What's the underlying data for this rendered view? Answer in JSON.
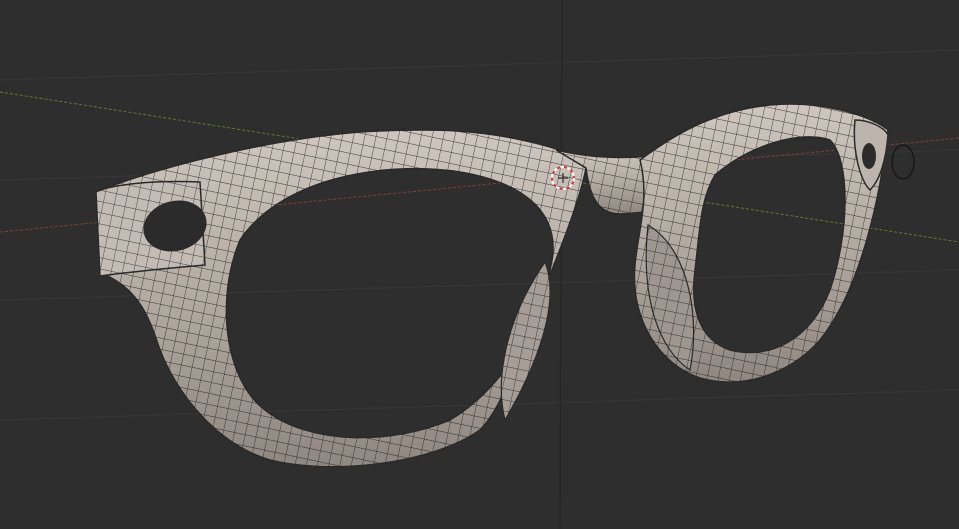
{
  "viewport": {
    "background": "#2e2e2e",
    "grid_line_color": "#3a3a3a",
    "x_axis_color": "#8a3b3b",
    "y_axis_color": "#5f7a2a",
    "mesh_color": "#b8afa6",
    "wire_color": "#1e1e1e",
    "cursor_colors": [
      "#d23b3b",
      "#ffffff"
    ]
  },
  "object": {
    "icon": "glasses-mesh"
  },
  "cursor": {
    "icon": "3d-cursor-icon"
  }
}
